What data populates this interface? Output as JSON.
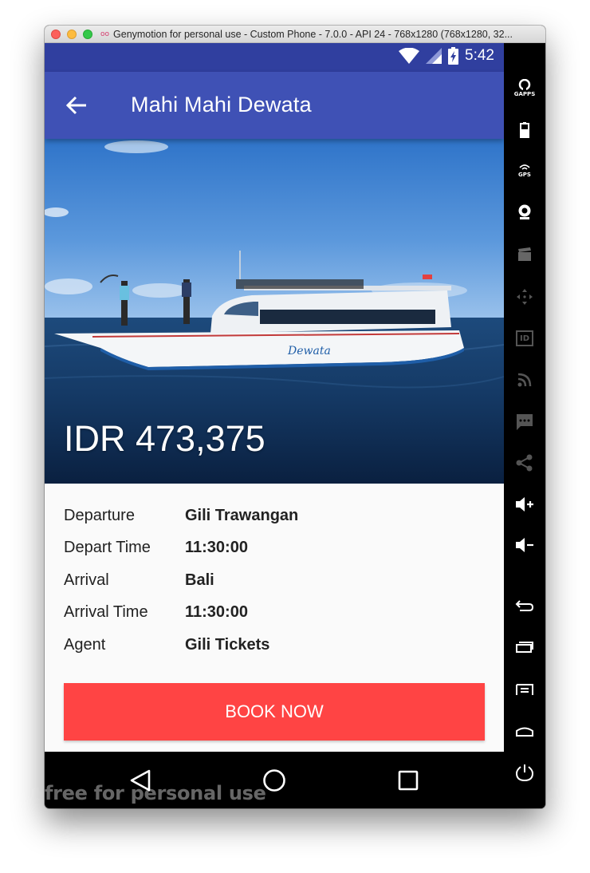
{
  "window": {
    "title": "Genymotion for personal use - Custom Phone - 7.0.0 - API 24 - 768x1280 (768x1280, 32...",
    "logo": "oo"
  },
  "statusbar": {
    "time": "5:42"
  },
  "appbar": {
    "title": "Mahi Mahi Dewata",
    "back_icon": "arrow-left-icon"
  },
  "hero": {
    "price": "IDR 473,375",
    "boat_name": "Dewata"
  },
  "details": [
    {
      "label": "Departure",
      "value": "Gili Trawangan"
    },
    {
      "label": "Depart Time",
      "value": "11:30:00"
    },
    {
      "label": "Arrival",
      "value": "Bali"
    },
    {
      "label": "Arrival Time",
      "value": "11:30:00"
    },
    {
      "label": "Agent",
      "value": "Gili Tickets"
    }
  ],
  "book_button": {
    "label": "BOOK NOW",
    "color": "#ff4444"
  },
  "watermark": "free for personal use",
  "sidebar": {
    "gapps_label": "GAPPS",
    "gps_label": "GPS",
    "id_label": "ID"
  },
  "colors": {
    "primary": "#3f51b5",
    "primary_dark": "#303f9f",
    "accent": "#ff4444"
  }
}
